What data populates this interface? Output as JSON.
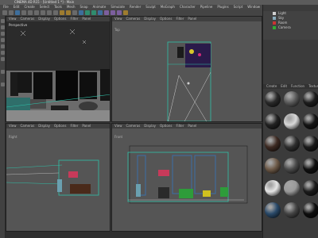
{
  "window": {
    "title": "CINEMA 4D R15 - [Untitled 1 *] - Main"
  },
  "menus": [
    "File",
    "Edit",
    "Create",
    "Select",
    "Tools",
    "Mesh",
    "Snap",
    "Animate",
    "Simulate",
    "Render",
    "Sculpt",
    "MoGraph",
    "Character",
    "Pipeline",
    "Plugins",
    "Script",
    "Window",
    "Help"
  ],
  "viewports": {
    "perspective": {
      "label": "Perspective",
      "menu": [
        "View",
        "Cameras",
        "Display",
        "Options",
        "Filter",
        "Panel"
      ]
    },
    "top": {
      "label": "Top",
      "menu": [
        "View",
        "Cameras",
        "Display",
        "Options",
        "Filter",
        "Panel"
      ]
    },
    "right": {
      "label": "Right",
      "menu": [
        "View",
        "Cameras",
        "Display",
        "Options",
        "Filter",
        "Panel"
      ]
    },
    "front": {
      "label": "Front",
      "menu": [
        "View",
        "Cameras",
        "Display",
        "Options",
        "Filter",
        "Panel"
      ]
    }
  },
  "objects_panel": {
    "rows": [
      "Light",
      "Sky",
      "Room",
      "Camera"
    ]
  },
  "materials_panel": {
    "tabs": [
      "Create",
      "Edit",
      "Function",
      "Texture"
    ],
    "swatches": [
      {
        "name": "mat-1",
        "color": "#2a2a2a"
      },
      {
        "name": "mat-2",
        "color": "#5a5a5a"
      },
      {
        "name": "mat-3",
        "color": "#1d1d1d"
      },
      {
        "name": "mat-4",
        "color": "#222"
      },
      {
        "name": "mat-5",
        "color": "#d8d8d8"
      },
      {
        "name": "mat-6",
        "color": "#141414"
      },
      {
        "name": "mat-7",
        "color": "#3d2a22"
      },
      {
        "name": "mat-8",
        "color": "#2f2f2f"
      },
      {
        "name": "mat-9",
        "color": "#1a1a1a"
      },
      {
        "name": "mat-10",
        "color": "#6e5a48"
      },
      {
        "name": "mat-11",
        "color": "#4a4a4a"
      },
      {
        "name": "mat-12",
        "color": "#111"
      },
      {
        "name": "mat-13",
        "color": "#e6e6e6"
      },
      {
        "name": "mat-14",
        "color": "#9a9a9a"
      },
      {
        "name": "mat-15",
        "color": "#1c1c1c"
      },
      {
        "name": "mat-16",
        "color": "#2a4a6a"
      },
      {
        "name": "mat-17",
        "color": "#454545"
      },
      {
        "name": "mat-18",
        "color": "#0e0e0e"
      }
    ]
  },
  "colors": {
    "accent": "#2fc0a8",
    "selection": "#3a6ea8"
  }
}
